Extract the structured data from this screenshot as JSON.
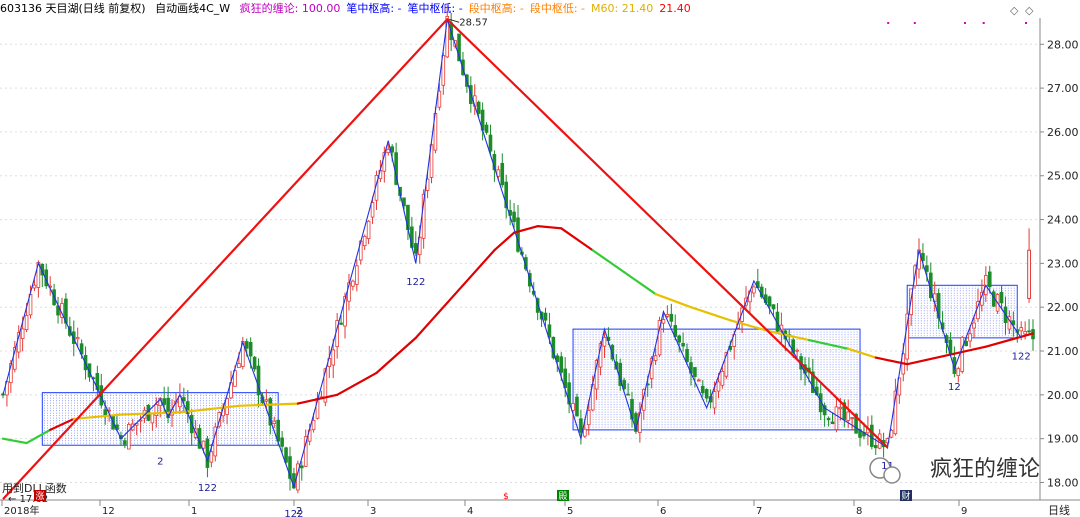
{
  "header": {
    "symbol": "603136 天目湖(日线 前复权)",
    "indicator_name": "自动画线4C_W",
    "fields": [
      {
        "label": "疯狂的缠论: 100.00",
        "color": "#c000c0"
      },
      {
        "label": "笔中枢高: -",
        "color": "#0000ff"
      },
      {
        "label": "笔中枢低: -",
        "color": "#0000ff"
      },
      {
        "label": "段中枢高: -",
        "color": "#ff8000"
      },
      {
        "label": "段中枢低: -",
        "color": "#ff8000"
      },
      {
        "label": "M60: 21.40",
        "color": "#e0b000"
      },
      {
        "label": "21.40",
        "color": "#ff0000"
      }
    ]
  },
  "footer": {
    "dll_text": "用到DLL函数",
    "period_label": "日线",
    "markers": [
      {
        "label": "涨",
        "color": "#c00000"
      },
      {
        "label": "$",
        "color": "#ff0000"
      },
      {
        "label": "殿",
        "color": "#008000"
      },
      {
        "label": "财",
        "color": "#203060"
      }
    ],
    "watermark": "疯狂的缠论"
  },
  "chart_data": {
    "type": "candlestick",
    "ylim": [
      17.6,
      28.6
    ],
    "y_ticks": [
      "18.00",
      "19.00",
      "20.00",
      "21.00",
      "22.00",
      "23.00",
      "24.00",
      "25.00",
      "26.00",
      "27.00",
      "28.00"
    ],
    "y_tick_values": [
      18,
      19,
      20,
      21,
      22,
      23,
      24,
      25,
      26,
      27,
      28
    ],
    "x_labels": [
      "2018年",
      "12",
      "1",
      "2",
      "3",
      "4",
      "5",
      "6",
      "7",
      "8",
      "9"
    ],
    "annotations": [
      {
        "text": "28.57",
        "value": 28.57
      },
      {
        "text": "17.62",
        "value": 17.62
      },
      {
        "text": "2"
      },
      {
        "text": "122"
      },
      {
        "text": "122"
      },
      {
        "text": "122"
      },
      {
        "text": "11"
      },
      {
        "text": "12"
      },
      {
        "text": "122"
      }
    ],
    "bi_points": [
      {
        "t": 0,
        "v": 20.0
      },
      {
        "t": 9,
        "v": 23.0
      },
      {
        "t": 30,
        "v": 19.0
      },
      {
        "t": 40,
        "v": 19.9
      },
      {
        "t": 42,
        "v": 19.5
      },
      {
        "t": 45,
        "v": 20.0
      },
      {
        "t": 52,
        "v": 18.5
      },
      {
        "t": 61,
        "v": 21.2
      },
      {
        "t": 74,
        "v": 17.9
      },
      {
        "t": 98,
        "v": 25.8
      },
      {
        "t": 105,
        "v": 23.0
      },
      {
        "t": 113,
        "v": 28.57
      },
      {
        "t": 147,
        "v": 19.0
      },
      {
        "t": 153,
        "v": 21.5
      },
      {
        "t": 161,
        "v": 19.2
      },
      {
        "t": 168,
        "v": 21.9
      },
      {
        "t": 179,
        "v": 19.7
      },
      {
        "t": 191,
        "v": 22.6
      },
      {
        "t": 209,
        "v": 19.7
      },
      {
        "t": 225,
        "v": 18.8
      },
      {
        "t": 233,
        "v": 23.3
      },
      {
        "t": 242,
        "v": 20.6
      },
      {
        "t": 250,
        "v": 22.5
      },
      {
        "t": 259,
        "v": 21.3
      }
    ],
    "segment_points": [
      {
        "t": 0,
        "v": 17.62
      },
      {
        "t": 113,
        "v": 28.57
      },
      {
        "t": 225,
        "v": 18.8
      }
    ],
    "pivots": [
      {
        "t0": 10,
        "t1": 70,
        "low": 18.85,
        "high": 20.05
      },
      {
        "t0": 145,
        "t1": 218,
        "low": 19.2,
        "high": 21.5
      },
      {
        "t0": 230,
        "t1": 258,
        "low": 21.3,
        "high": 22.5
      }
    ],
    "ma60": [
      {
        "t": 0,
        "v": 19.0
      },
      {
        "t": 6,
        "v": 18.9
      },
      {
        "t": 12,
        "v": 19.2
      },
      {
        "t": 18,
        "v": 19.45
      },
      {
        "t": 30,
        "v": 19.55
      },
      {
        "t": 45,
        "v": 19.6
      },
      {
        "t": 60,
        "v": 19.75
      },
      {
        "t": 75,
        "v": 19.8
      },
      {
        "t": 85,
        "v": 20.0
      },
      {
        "t": 95,
        "v": 20.5
      },
      {
        "t": 105,
        "v": 21.3
      },
      {
        "t": 115,
        "v": 22.3
      },
      {
        "t": 125,
        "v": 23.3
      },
      {
        "t": 130,
        "v": 23.7
      },
      {
        "t": 136,
        "v": 23.85
      },
      {
        "t": 142,
        "v": 23.8
      },
      {
        "t": 150,
        "v": 23.3
      },
      {
        "t": 158,
        "v": 22.8
      },
      {
        "t": 166,
        "v": 22.3
      },
      {
        "t": 175,
        "v": 22.0
      },
      {
        "t": 185,
        "v": 21.7
      },
      {
        "t": 195,
        "v": 21.45
      },
      {
        "t": 205,
        "v": 21.25
      },
      {
        "t": 215,
        "v": 21.05
      },
      {
        "t": 222,
        "v": 20.85
      },
      {
        "t": 230,
        "v": 20.7
      },
      {
        "t": 240,
        "v": 20.9
      },
      {
        "t": 250,
        "v": 21.1
      },
      {
        "t": 262,
        "v": 21.4
      }
    ],
    "last_price": 21.4
  }
}
